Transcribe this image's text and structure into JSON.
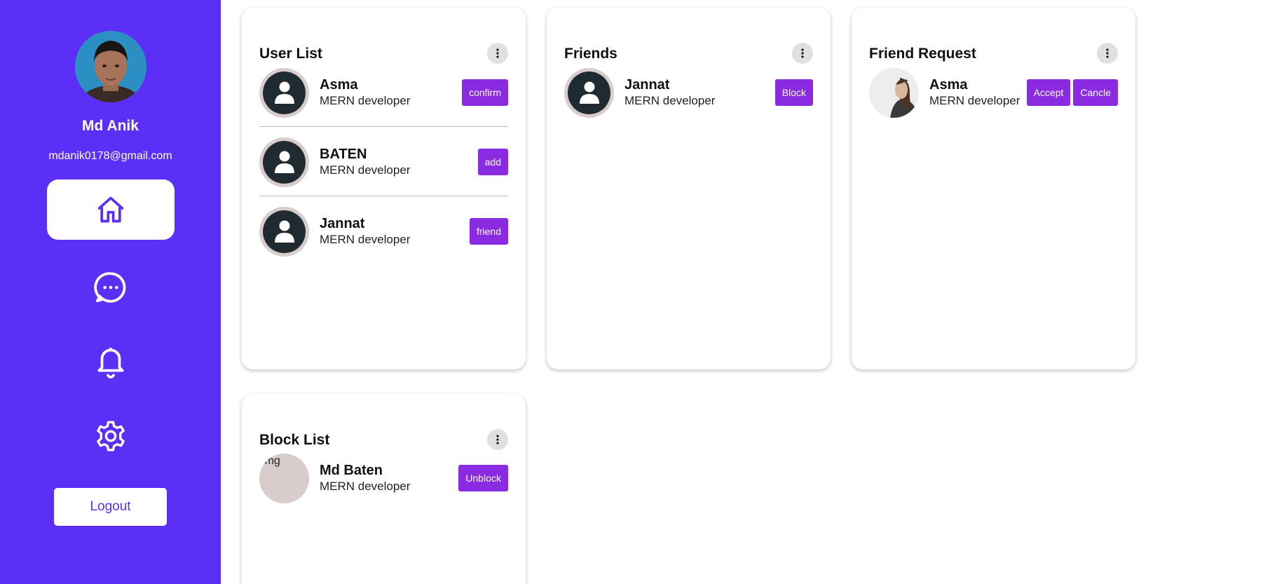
{
  "profile": {
    "name": "Md Anik",
    "email": "mdanik0178@gmail.com",
    "logout_label": "Logout"
  },
  "nav": {
    "items": [
      {
        "icon": "home-icon",
        "active": true
      },
      {
        "icon": "chat-icon",
        "active": false
      },
      {
        "icon": "bell-icon",
        "active": false
      },
      {
        "icon": "gear-icon",
        "active": false
      }
    ]
  },
  "colors": {
    "sidebar": "#5b2ff5",
    "button": "#8a2be2",
    "avatar_ring": "#d8cccc",
    "avatar_fill": "#1f2b30"
  },
  "user_list": {
    "title": "User List",
    "items": [
      {
        "name": "Asma",
        "role": "MERN developer",
        "action": "confirm"
      },
      {
        "name": "BATEN",
        "role": "MERN developer",
        "action": "add"
      },
      {
        "name": "Jannat",
        "role": "MERN developer",
        "action": "friend"
      }
    ]
  },
  "friends": {
    "title": "Friends",
    "items": [
      {
        "name": "Jannat",
        "role": "MERN developer",
        "action": "Block"
      }
    ]
  },
  "friend_request": {
    "title": "Friend Request",
    "items": [
      {
        "name": "Asma",
        "role": "MERN developer",
        "accept": "Accept",
        "cancel": "Cancle"
      }
    ]
  },
  "block_list": {
    "title": "Block List",
    "items": [
      {
        "name": "Md Baten",
        "role": "MERN developer",
        "action": "Unblock",
        "img_alt": "img"
      }
    ]
  }
}
